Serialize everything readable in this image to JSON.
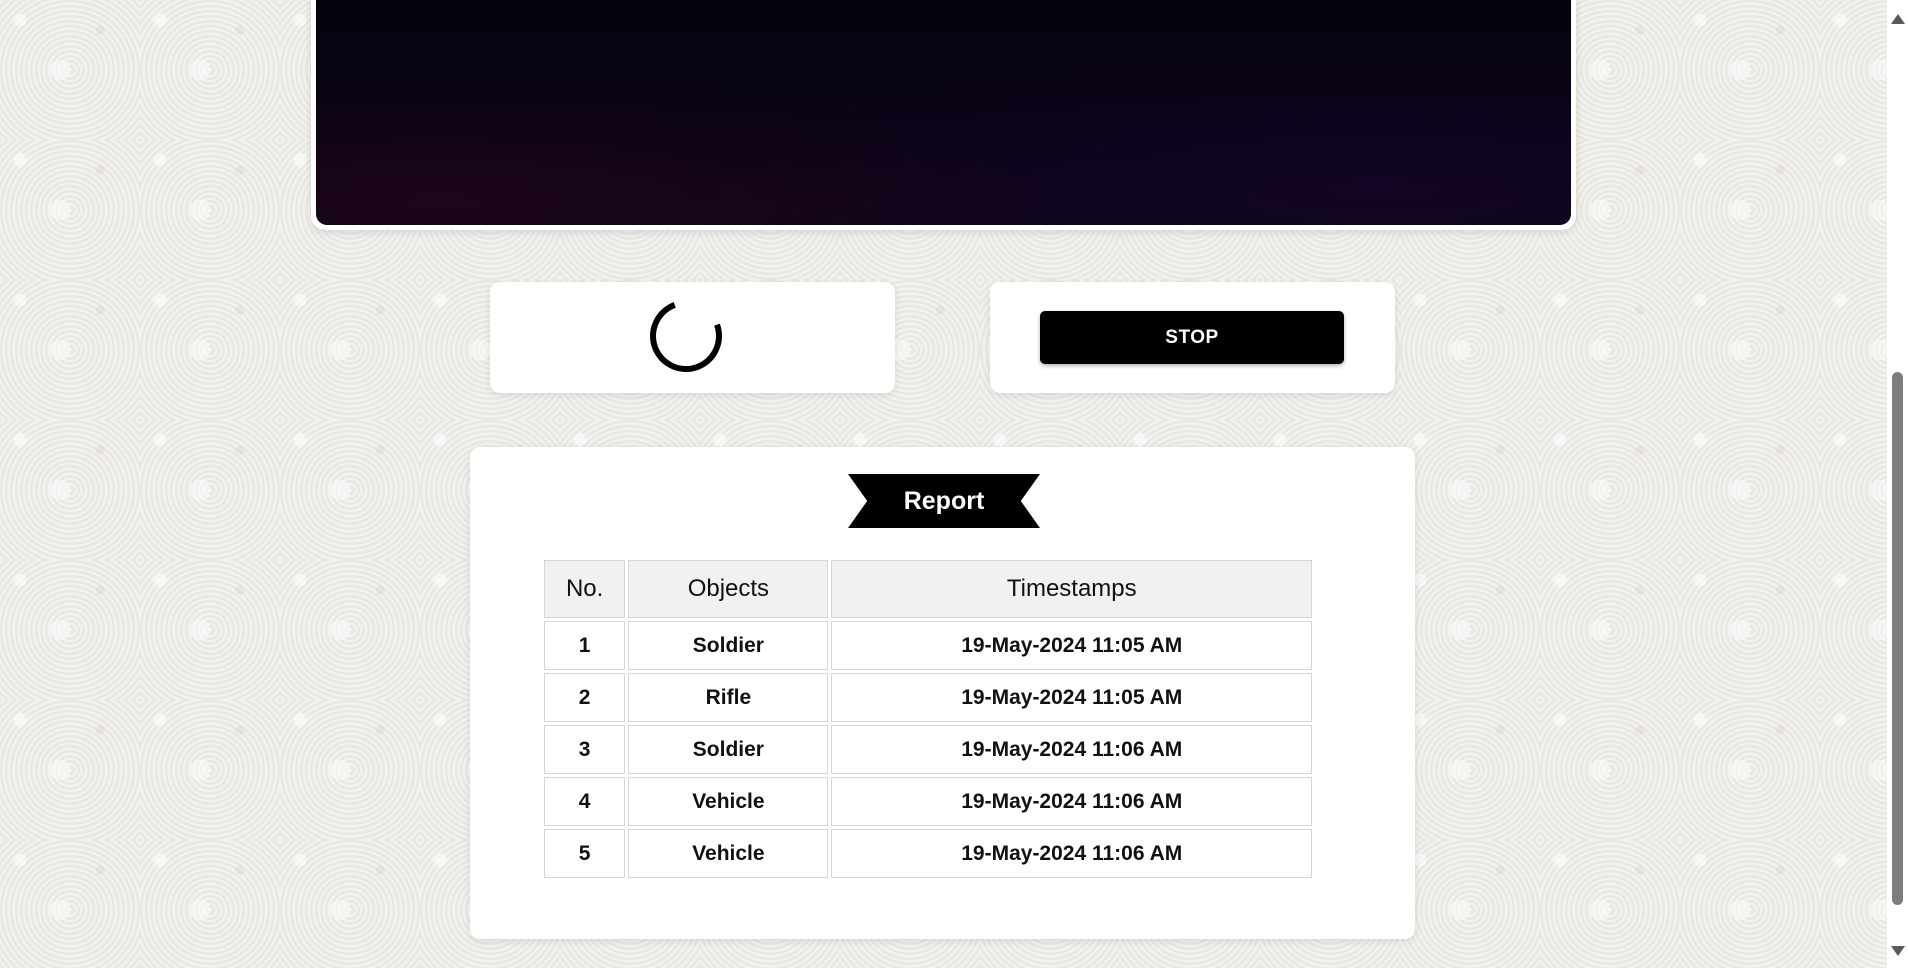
{
  "video": {
    "state": "live"
  },
  "controls": {
    "spinner_icon": "loading-spinner-icon",
    "stop_label": "STOP"
  },
  "report": {
    "title": "Report",
    "columns": [
      "No.",
      "Objects",
      "Timestamps"
    ],
    "rows": [
      {
        "no": "1",
        "object": "Soldier",
        "timestamp": "19-May-2024 11:05 AM"
      },
      {
        "no": "2",
        "object": "Rifle",
        "timestamp": "19-May-2024 11:05 AM"
      },
      {
        "no": "3",
        "object": "Soldier",
        "timestamp": "19-May-2024 11:06 AM"
      },
      {
        "no": "4",
        "object": "Vehicle",
        "timestamp": "19-May-2024 11:06 AM"
      },
      {
        "no": "5",
        "object": "Vehicle",
        "timestamp": "19-May-2024 11:06 AM"
      }
    ]
  },
  "colors": {
    "accent": "#000000",
    "card_background": "#ffffff",
    "page_background": "#ecebe6"
  }
}
